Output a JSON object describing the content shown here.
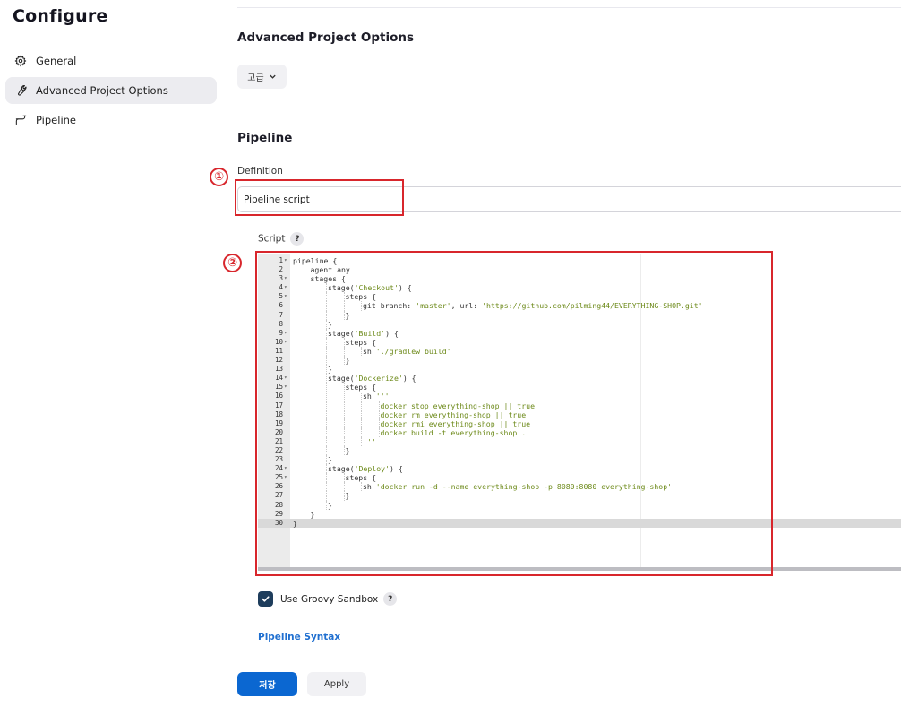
{
  "sidebar": {
    "title": "Configure",
    "items": [
      {
        "label": "General",
        "icon": "gear-icon"
      },
      {
        "label": "Advanced Project Options",
        "icon": "wrench-icon",
        "active": true
      },
      {
        "label": "Pipeline",
        "icon": "pipeline-icon"
      }
    ]
  },
  "advanced": {
    "title": "Advanced Project Options",
    "button_label": "고급"
  },
  "pipeline": {
    "title": "Pipeline",
    "definition_label": "Definition",
    "definition_value": "Pipeline script",
    "script_label": "Script",
    "help_glyph": "?",
    "code_lines": [
      {
        "n": "1",
        "fold": true,
        "indent": 0,
        "segs": [
          [
            "pipeline {",
            ""
          ]
        ]
      },
      {
        "n": "2",
        "fold": false,
        "indent": 1,
        "segs": [
          [
            "agent any",
            ""
          ]
        ]
      },
      {
        "n": "3",
        "fold": true,
        "indent": 1,
        "segs": [
          [
            "stages {",
            ""
          ]
        ]
      },
      {
        "n": "4",
        "fold": true,
        "indent": 2,
        "segs": [
          [
            "stage(",
            ""
          ],
          [
            "'Checkout'",
            "s"
          ],
          [
            ") {",
            ""
          ]
        ]
      },
      {
        "n": "5",
        "fold": true,
        "indent": 3,
        "segs": [
          [
            "steps {",
            ""
          ]
        ]
      },
      {
        "n": "6",
        "fold": false,
        "indent": 4,
        "segs": [
          [
            "git branch: ",
            ""
          ],
          [
            "'master'",
            "s"
          ],
          [
            ", url: ",
            ""
          ],
          [
            "'https://github.com/pilming44/EVERYTHING-SHOP.git'",
            "s"
          ]
        ]
      },
      {
        "n": "7",
        "fold": false,
        "indent": 3,
        "segs": [
          [
            "}",
            ""
          ]
        ]
      },
      {
        "n": "8",
        "fold": false,
        "indent": 2,
        "segs": [
          [
            "}",
            ""
          ]
        ]
      },
      {
        "n": "9",
        "fold": true,
        "indent": 2,
        "segs": [
          [
            "stage(",
            ""
          ],
          [
            "'Build'",
            "s"
          ],
          [
            ") {",
            ""
          ]
        ]
      },
      {
        "n": "10",
        "fold": true,
        "indent": 3,
        "segs": [
          [
            "steps {",
            ""
          ]
        ]
      },
      {
        "n": "11",
        "fold": false,
        "indent": 4,
        "segs": [
          [
            "sh ",
            ""
          ],
          [
            "'./gradlew build'",
            "s"
          ]
        ]
      },
      {
        "n": "12",
        "fold": false,
        "indent": 3,
        "segs": [
          [
            "}",
            ""
          ]
        ]
      },
      {
        "n": "13",
        "fold": false,
        "indent": 2,
        "segs": [
          [
            "}",
            ""
          ]
        ]
      },
      {
        "n": "14",
        "fold": true,
        "indent": 2,
        "segs": [
          [
            "stage(",
            ""
          ],
          [
            "'Dockerize'",
            "s"
          ],
          [
            ") {",
            ""
          ]
        ]
      },
      {
        "n": "15",
        "fold": true,
        "indent": 3,
        "segs": [
          [
            "steps {",
            ""
          ]
        ]
      },
      {
        "n": "16",
        "fold": false,
        "indent": 4,
        "segs": [
          [
            "sh ",
            ""
          ],
          [
            "'''",
            "s"
          ]
        ]
      },
      {
        "n": "17",
        "fold": false,
        "indent": 5,
        "segs": [
          [
            "docker stop everything-shop || true",
            "s"
          ]
        ]
      },
      {
        "n": "18",
        "fold": false,
        "indent": 5,
        "segs": [
          [
            "docker rm everything-shop || true",
            "s"
          ]
        ]
      },
      {
        "n": "19",
        "fold": false,
        "indent": 5,
        "segs": [
          [
            "docker rmi everything-shop || true",
            "s"
          ]
        ]
      },
      {
        "n": "20",
        "fold": false,
        "indent": 5,
        "segs": [
          [
            "docker build -t everything-shop .",
            "s"
          ]
        ]
      },
      {
        "n": "21",
        "fold": false,
        "indent": 4,
        "segs": [
          [
            "'''",
            "s"
          ]
        ]
      },
      {
        "n": "22",
        "fold": false,
        "indent": 3,
        "segs": [
          [
            "}",
            ""
          ]
        ]
      },
      {
        "n": "23",
        "fold": false,
        "indent": 2,
        "segs": [
          [
            "}",
            ""
          ]
        ]
      },
      {
        "n": "24",
        "fold": true,
        "indent": 2,
        "segs": [
          [
            "stage(",
            ""
          ],
          [
            "'Deploy'",
            "s"
          ],
          [
            ") {",
            ""
          ]
        ]
      },
      {
        "n": "25",
        "fold": true,
        "indent": 3,
        "segs": [
          [
            "steps {",
            ""
          ]
        ]
      },
      {
        "n": "26",
        "fold": false,
        "indent": 4,
        "segs": [
          [
            "sh ",
            ""
          ],
          [
            "'docker run -d --name everything-shop -p 8080:8080 everything-shop'",
            "s"
          ]
        ]
      },
      {
        "n": "27",
        "fold": false,
        "indent": 3,
        "segs": [
          [
            "}",
            ""
          ]
        ]
      },
      {
        "n": "28",
        "fold": false,
        "indent": 2,
        "segs": [
          [
            "}",
            ""
          ]
        ]
      },
      {
        "n": "29",
        "fold": false,
        "indent": 1,
        "segs": [
          [
            "}",
            ""
          ]
        ]
      },
      {
        "n": "30",
        "fold": false,
        "indent": 0,
        "active": true,
        "segs": [
          [
            "}",
            ""
          ]
        ]
      }
    ],
    "sandbox_label": "Use Groovy Sandbox",
    "sandbox_checked": true,
    "syntax_link": "Pipeline Syntax"
  },
  "annotations": [
    "①",
    "②"
  ],
  "buttons": {
    "save": "저장",
    "apply": "Apply"
  },
  "colors": {
    "primary": "#0b67d1",
    "annotation": "#d8262c",
    "string": "#6d8a1a",
    "checkbox": "#1e3d5c"
  }
}
